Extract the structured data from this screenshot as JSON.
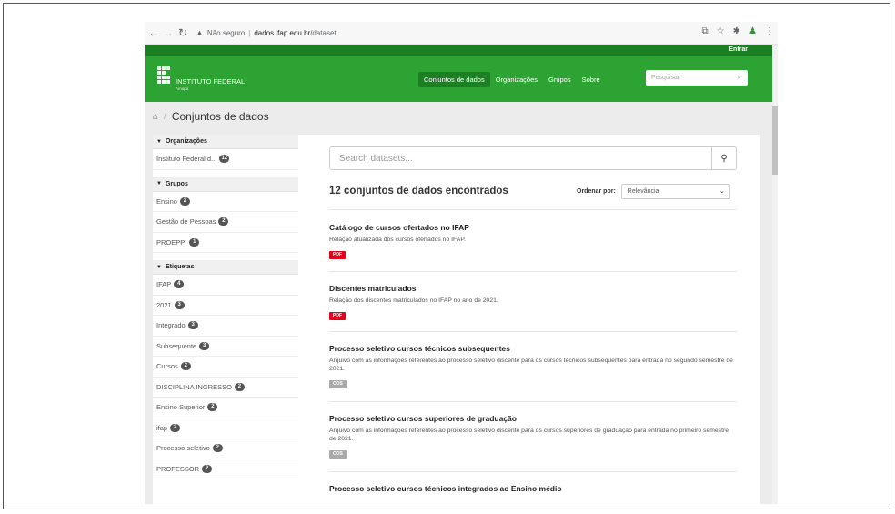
{
  "browser": {
    "security_label": "Não seguro",
    "url_domain": "dados.ifap.edu.br",
    "url_path": "/dataset"
  },
  "topbar": {
    "login": "Entrar"
  },
  "header": {
    "logo_title": "INSTITUTO FEDERAL",
    "logo_subtitle": "Amapá",
    "nav": [
      "Conjuntos de dados",
      "Organizações",
      "Grupos",
      "Sobre"
    ],
    "search_placeholder": "Pesquisar"
  },
  "breadcrumb": {
    "current": "Conjuntos de dados"
  },
  "sidebar": {
    "organizations": {
      "title": "Organizações",
      "items": [
        {
          "label": "Instituto Federal d...",
          "count": "12"
        }
      ]
    },
    "groups": {
      "title": "Grupos",
      "items": [
        {
          "label": "Ensino",
          "count": "2"
        },
        {
          "label": "Gestão de Pessoas",
          "count": "2"
        },
        {
          "label": "PROEPPI",
          "count": "1"
        }
      ]
    },
    "tags": {
      "title": "Etiquetas",
      "items": [
        {
          "label": "IFAP",
          "count": "4"
        },
        {
          "label": "2021",
          "count": "3"
        },
        {
          "label": "Integrado",
          "count": "3"
        },
        {
          "label": "Subsequente",
          "count": "3"
        },
        {
          "label": "Cursos",
          "count": "2"
        },
        {
          "label": "DISCIPLINA INGRESSO",
          "count": "2"
        },
        {
          "label": "Ensino Superior",
          "count": "2"
        },
        {
          "label": "ifap",
          "count": "2"
        },
        {
          "label": "Processo seletivo",
          "count": "2"
        },
        {
          "label": "PROFESSOR",
          "count": "2"
        }
      ]
    }
  },
  "main": {
    "search_placeholder": "Search datasets...",
    "results_title": "12 conjuntos de dados encontrados",
    "sort_label": "Ordenar por:",
    "sort_value": "Relevância",
    "datasets": [
      {
        "title": "Catálogo de cursos ofertados no IFAP",
        "description": "Relação atualizada dos cursos ofertados no IFAP.",
        "format": "PDF"
      },
      {
        "title": "Discentes matriculados",
        "description": "Relação dos discentes matriculados no IFAP no ano de 2021.",
        "format": "PDF"
      },
      {
        "title": "Processo seletivo cursos técnicos subsequentes",
        "description": "Arquivo com as informações referentes ao processo seletivo discente para os cursos técnicos subsequentes para entrada no segundo semestre de 2021.",
        "format": "ODS"
      },
      {
        "title": "Processo seletivo cursos superiores de graduação",
        "description": "Arquivo com as informações referentes ao processo seletivo discente para os cursos superiores de graduação para entrada no primeiro semestre de 2021.",
        "format": "ODS"
      },
      {
        "title": "Processo seletivo cursos técnicos integrados ao Ensino médio",
        "description": "",
        "format": ""
      }
    ]
  },
  "colors": {
    "header_green": "#2ca332",
    "topbar_green": "#1d7f24",
    "pdf_red": "#e0051e",
    "ods_gray": "#aaaaaa"
  }
}
